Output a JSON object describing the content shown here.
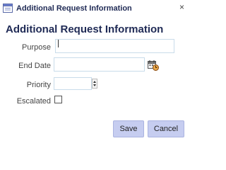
{
  "window": {
    "title": "Additional Request Information",
    "close_label": "×"
  },
  "form": {
    "heading": "Additional Request Information",
    "purpose": {
      "label": "Purpose",
      "value": ""
    },
    "end_date": {
      "label": "End Date",
      "value": ""
    },
    "priority": {
      "label": "Priority",
      "value": ""
    },
    "escalated": {
      "label": "Escalated",
      "checked": false
    }
  },
  "buttons": {
    "save_label": "Save",
    "cancel_label": "Cancel"
  },
  "icons": {
    "window": "window-icon",
    "close": "close-icon",
    "calendar": "calendar-clock-icon",
    "spinner": "spinner-arrows-icon"
  },
  "colors": {
    "title_text": "#1f2a55",
    "field_border": "#c9dcea",
    "button_bg": "#c6cdf0"
  }
}
